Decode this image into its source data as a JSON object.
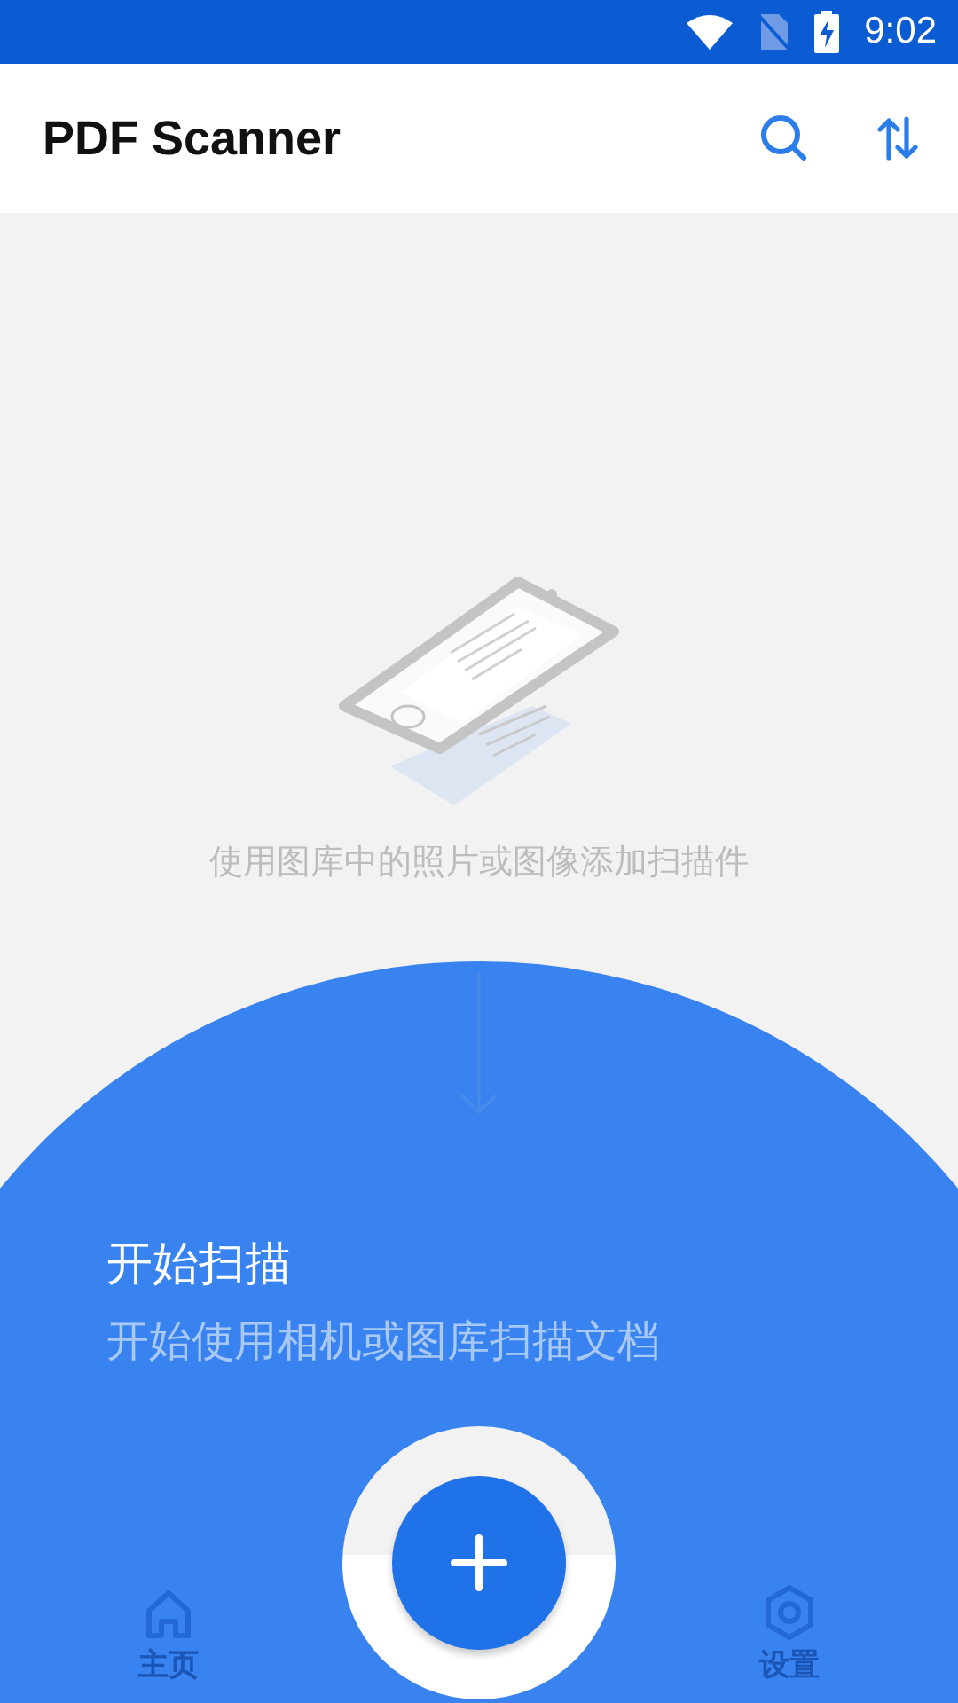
{
  "status_bar": {
    "time": "9:02"
  },
  "app_bar": {
    "title": "PDF Scanner"
  },
  "empty_state": {
    "hint": "使用图库中的照片或图像添加扫描件"
  },
  "scan_prompt": {
    "title": "开始扫描",
    "subtitle": "开始使用相机或图库扫描文档"
  },
  "bottom_nav": [
    {
      "label": "主页",
      "kind": "home"
    },
    {
      "label": "设置",
      "kind": "settings"
    }
  ]
}
